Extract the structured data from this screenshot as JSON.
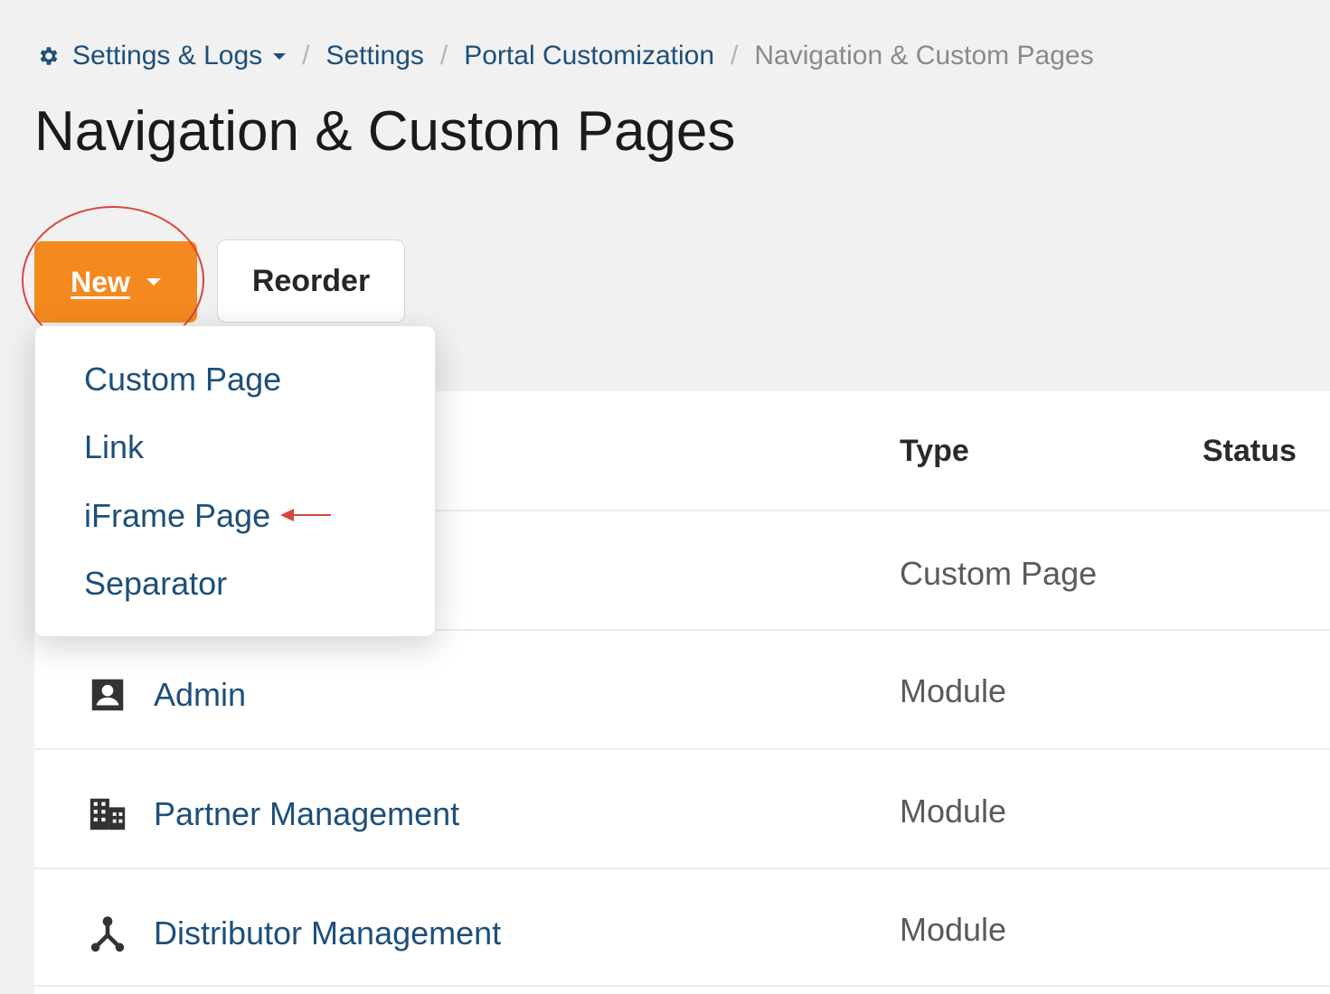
{
  "breadcrumb": {
    "root": "Settings & Logs",
    "item1": "Settings",
    "item2": "Portal Customization",
    "current": "Navigation & Custom Pages",
    "separator": "/"
  },
  "page_title": "Navigation & Custom Pages",
  "toolbar": {
    "new_label": "New",
    "reorder_label": "Reorder"
  },
  "dropdown": {
    "items": [
      {
        "label": "Custom Page"
      },
      {
        "label": "Link"
      },
      {
        "label": "iFrame Page"
      },
      {
        "label": "Separator"
      }
    ]
  },
  "table": {
    "columns": {
      "type": "Type",
      "status": "Status"
    },
    "rows": [
      {
        "name": "",
        "type": "Custom Page"
      },
      {
        "name": "Admin",
        "icon": "contact-card-icon",
        "type": "Module"
      },
      {
        "name": "Partner Management",
        "icon": "building-icon",
        "type": "Module"
      },
      {
        "name": "Distributor Management",
        "icon": "hierarchy-icon",
        "type": "Module"
      }
    ]
  },
  "colors": {
    "accent": "#f4891f",
    "link": "#1d4f7a",
    "annotation": "#d9453a"
  }
}
